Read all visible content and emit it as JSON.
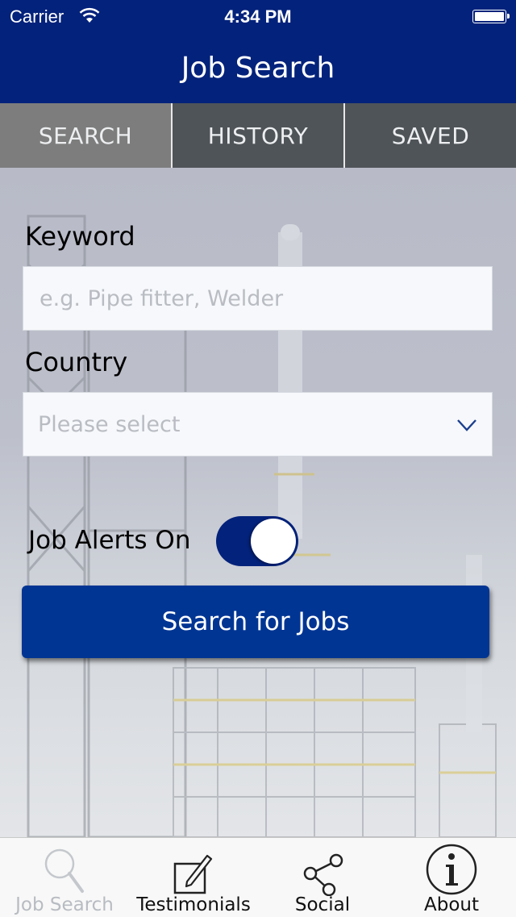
{
  "status_bar": {
    "carrier": "Carrier",
    "time": "4:34 PM",
    "wifi_icon": "wifi-icon",
    "battery_icon": "battery-icon",
    "battery_level_percent": 100
  },
  "nav": {
    "title": "Job Search"
  },
  "segments": [
    {
      "label": "SEARCH",
      "active": true
    },
    {
      "label": "HISTORY",
      "active": false
    },
    {
      "label": "SAVED",
      "active": false
    }
  ],
  "form": {
    "keyword_label": "Keyword",
    "keyword_placeholder": "e.g. Pipe fitter, Welder",
    "keyword_value": "",
    "country_label": "Country",
    "country_value": "Please select",
    "country_icon": "chevron-down-icon",
    "alerts_label": "Job Alerts On",
    "alerts_on": true,
    "submit_label": "Search for Jobs"
  },
  "tab_bar": [
    {
      "label": "Job Search",
      "icon": "search-icon",
      "active": true
    },
    {
      "label": "Testimonials",
      "icon": "compose-icon",
      "active": false
    },
    {
      "label": "Social",
      "icon": "share-icon",
      "active": false
    },
    {
      "label": "About",
      "icon": "info-icon",
      "active": false
    }
  ],
  "colors": {
    "brand_blue": "#03227b",
    "button_blue": "#003593",
    "segment_dark": "#4f5458",
    "segment_active": "#7d7d7d"
  }
}
